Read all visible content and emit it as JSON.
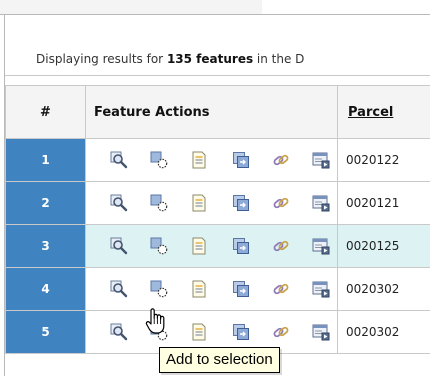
{
  "results": {
    "prefix": "Displaying results for ",
    "count_text": "135 features",
    "suffix": " in the D"
  },
  "table": {
    "headers": {
      "num": "#",
      "actions": "Feature Actions",
      "parcel": "Parcel"
    },
    "rows": [
      {
        "num": "1",
        "parcel": "0020122",
        "highlighted": false
      },
      {
        "num": "2",
        "parcel": "0020121",
        "highlighted": false
      },
      {
        "num": "3",
        "parcel": "0020125",
        "highlighted": true
      },
      {
        "num": "4",
        "parcel": "0020302",
        "highlighted": false
      },
      {
        "num": "5",
        "parcel": "0020302",
        "highlighted": false
      }
    ],
    "row_actions": [
      "zoom-to-feature-icon",
      "add-to-selection-icon",
      "view-details-icon",
      "copy-feature-icon",
      "attach-link-icon",
      "export-window-icon"
    ]
  },
  "tooltip": {
    "text": "Add to selection"
  },
  "colors": {
    "row_number_bg": "#3f84c0",
    "highlight_row": "#ddf3f3",
    "tooltip_bg": "#ffffe1"
  }
}
